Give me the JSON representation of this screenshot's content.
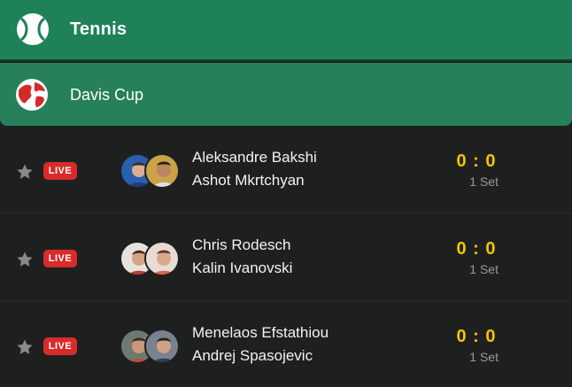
{
  "sport": {
    "title": "Tennis",
    "icon": "tennis-ball-icon"
  },
  "league": {
    "title": "Davis Cup",
    "icon": "globe-icon"
  },
  "matches": [
    {
      "status": "LIVE",
      "player1": "Aleksandre Bakshi",
      "player2": "Ashot Mkrtchyan",
      "score": "0 : 0",
      "period": "1 Set"
    },
    {
      "status": "LIVE",
      "player1": "Chris Rodesch",
      "player2": "Kalin Ivanovski",
      "score": "0 : 0",
      "period": "1 Set"
    },
    {
      "status": "LIVE",
      "player1": "Menelaos Efstathiou",
      "player2": "Andrej Spasojevic",
      "score": "0 : 0",
      "period": "1 Set"
    }
  ],
  "colors": {
    "header_green": "#1f8158",
    "live_red": "#d92b2b",
    "score_yellow": "#f5c400",
    "background": "#1e2020"
  }
}
